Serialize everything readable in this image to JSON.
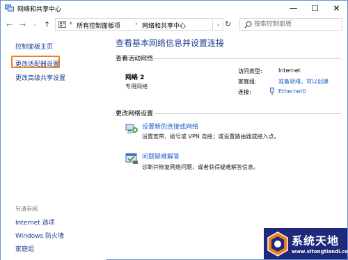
{
  "window": {
    "title": "网络和共享中心",
    "controls": {
      "minimize": "—",
      "maximize": "☐",
      "close": "✕"
    }
  },
  "nav": {
    "back": "←",
    "forward": "→",
    "history": "⌄",
    "up": "↑",
    "address_separator": "«",
    "address": [
      "所有控制面板项",
      "网络和共享中心"
    ],
    "address_chevron": "›",
    "dropdown": "⌄",
    "refresh": "↻",
    "search_placeholder": "搜索控制面板"
  },
  "sidebar": {
    "home": "控制面板主页",
    "change_adapter": "更改适配器设置",
    "change_advanced_sharing": "更改高级共享设置",
    "see_also_label": "另请参阅",
    "see_also": [
      "Internet 选项",
      "Windows 防火墙",
      "家庭组"
    ]
  },
  "main": {
    "title": "查看基本网络信息并设置连接",
    "active_networks_header": "查看活动网络",
    "network": {
      "name": "网络 2",
      "type": "专用网络",
      "access_type_label": "访问类型:",
      "access_type_value": "Internet",
      "homegroup_label": "家庭组:",
      "homegroup_value": "准备就绪，可以创建",
      "connections_label": "连接:",
      "connections_value": "Ethernet0"
    },
    "change_settings_header": "更改网络设置",
    "tasks": [
      {
        "label": "设置新的连接或网络",
        "desc": "设置宽带、拨号或 VPN 连接；或设置路由器或接入点。"
      },
      {
        "label": "问题疑难解答",
        "desc": "诊断并修复网络问题，或者获得疑难解答信息。"
      }
    ]
  },
  "watermark": {
    "title": "系统天地",
    "url": "www.xitongtiandi.com"
  },
  "colors": {
    "link": "#1a5fc8",
    "title_blue": "#1e3d8f",
    "highlight_box": "#f07c1a",
    "watermark_bg": "#1f2b7a"
  }
}
